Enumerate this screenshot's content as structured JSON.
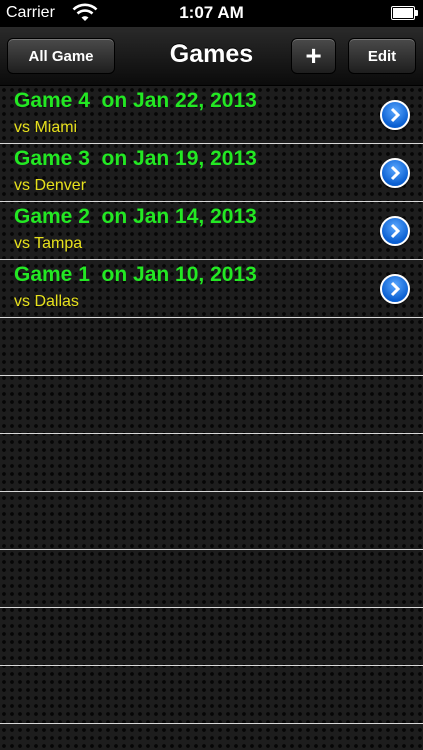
{
  "status": {
    "carrier": "Carrier",
    "time": "1:07 AM"
  },
  "nav": {
    "left_button": "All Game",
    "title": "Games",
    "add_label": "+",
    "edit_label": "Edit"
  },
  "games": [
    {
      "title": "Game 4  on Jan 22, 2013",
      "opponent": "vs Miami"
    },
    {
      "title": "Game 3  on Jan 19, 2013",
      "opponent": "vs Denver"
    },
    {
      "title": "Game 2  on Jan 14, 2013",
      "opponent": "vs Tampa"
    },
    {
      "title": "Game 1  on Jan 10, 2013",
      "opponent": "vs Dallas"
    }
  ],
  "colors": {
    "title": "#23e823",
    "subtitle": "#e6e01c",
    "disclosure": "#1a73e8"
  },
  "icons": {
    "row_accessory": "chevron-right-circle-icon",
    "wifi": "wifi-icon",
    "battery": "battery-icon"
  }
}
